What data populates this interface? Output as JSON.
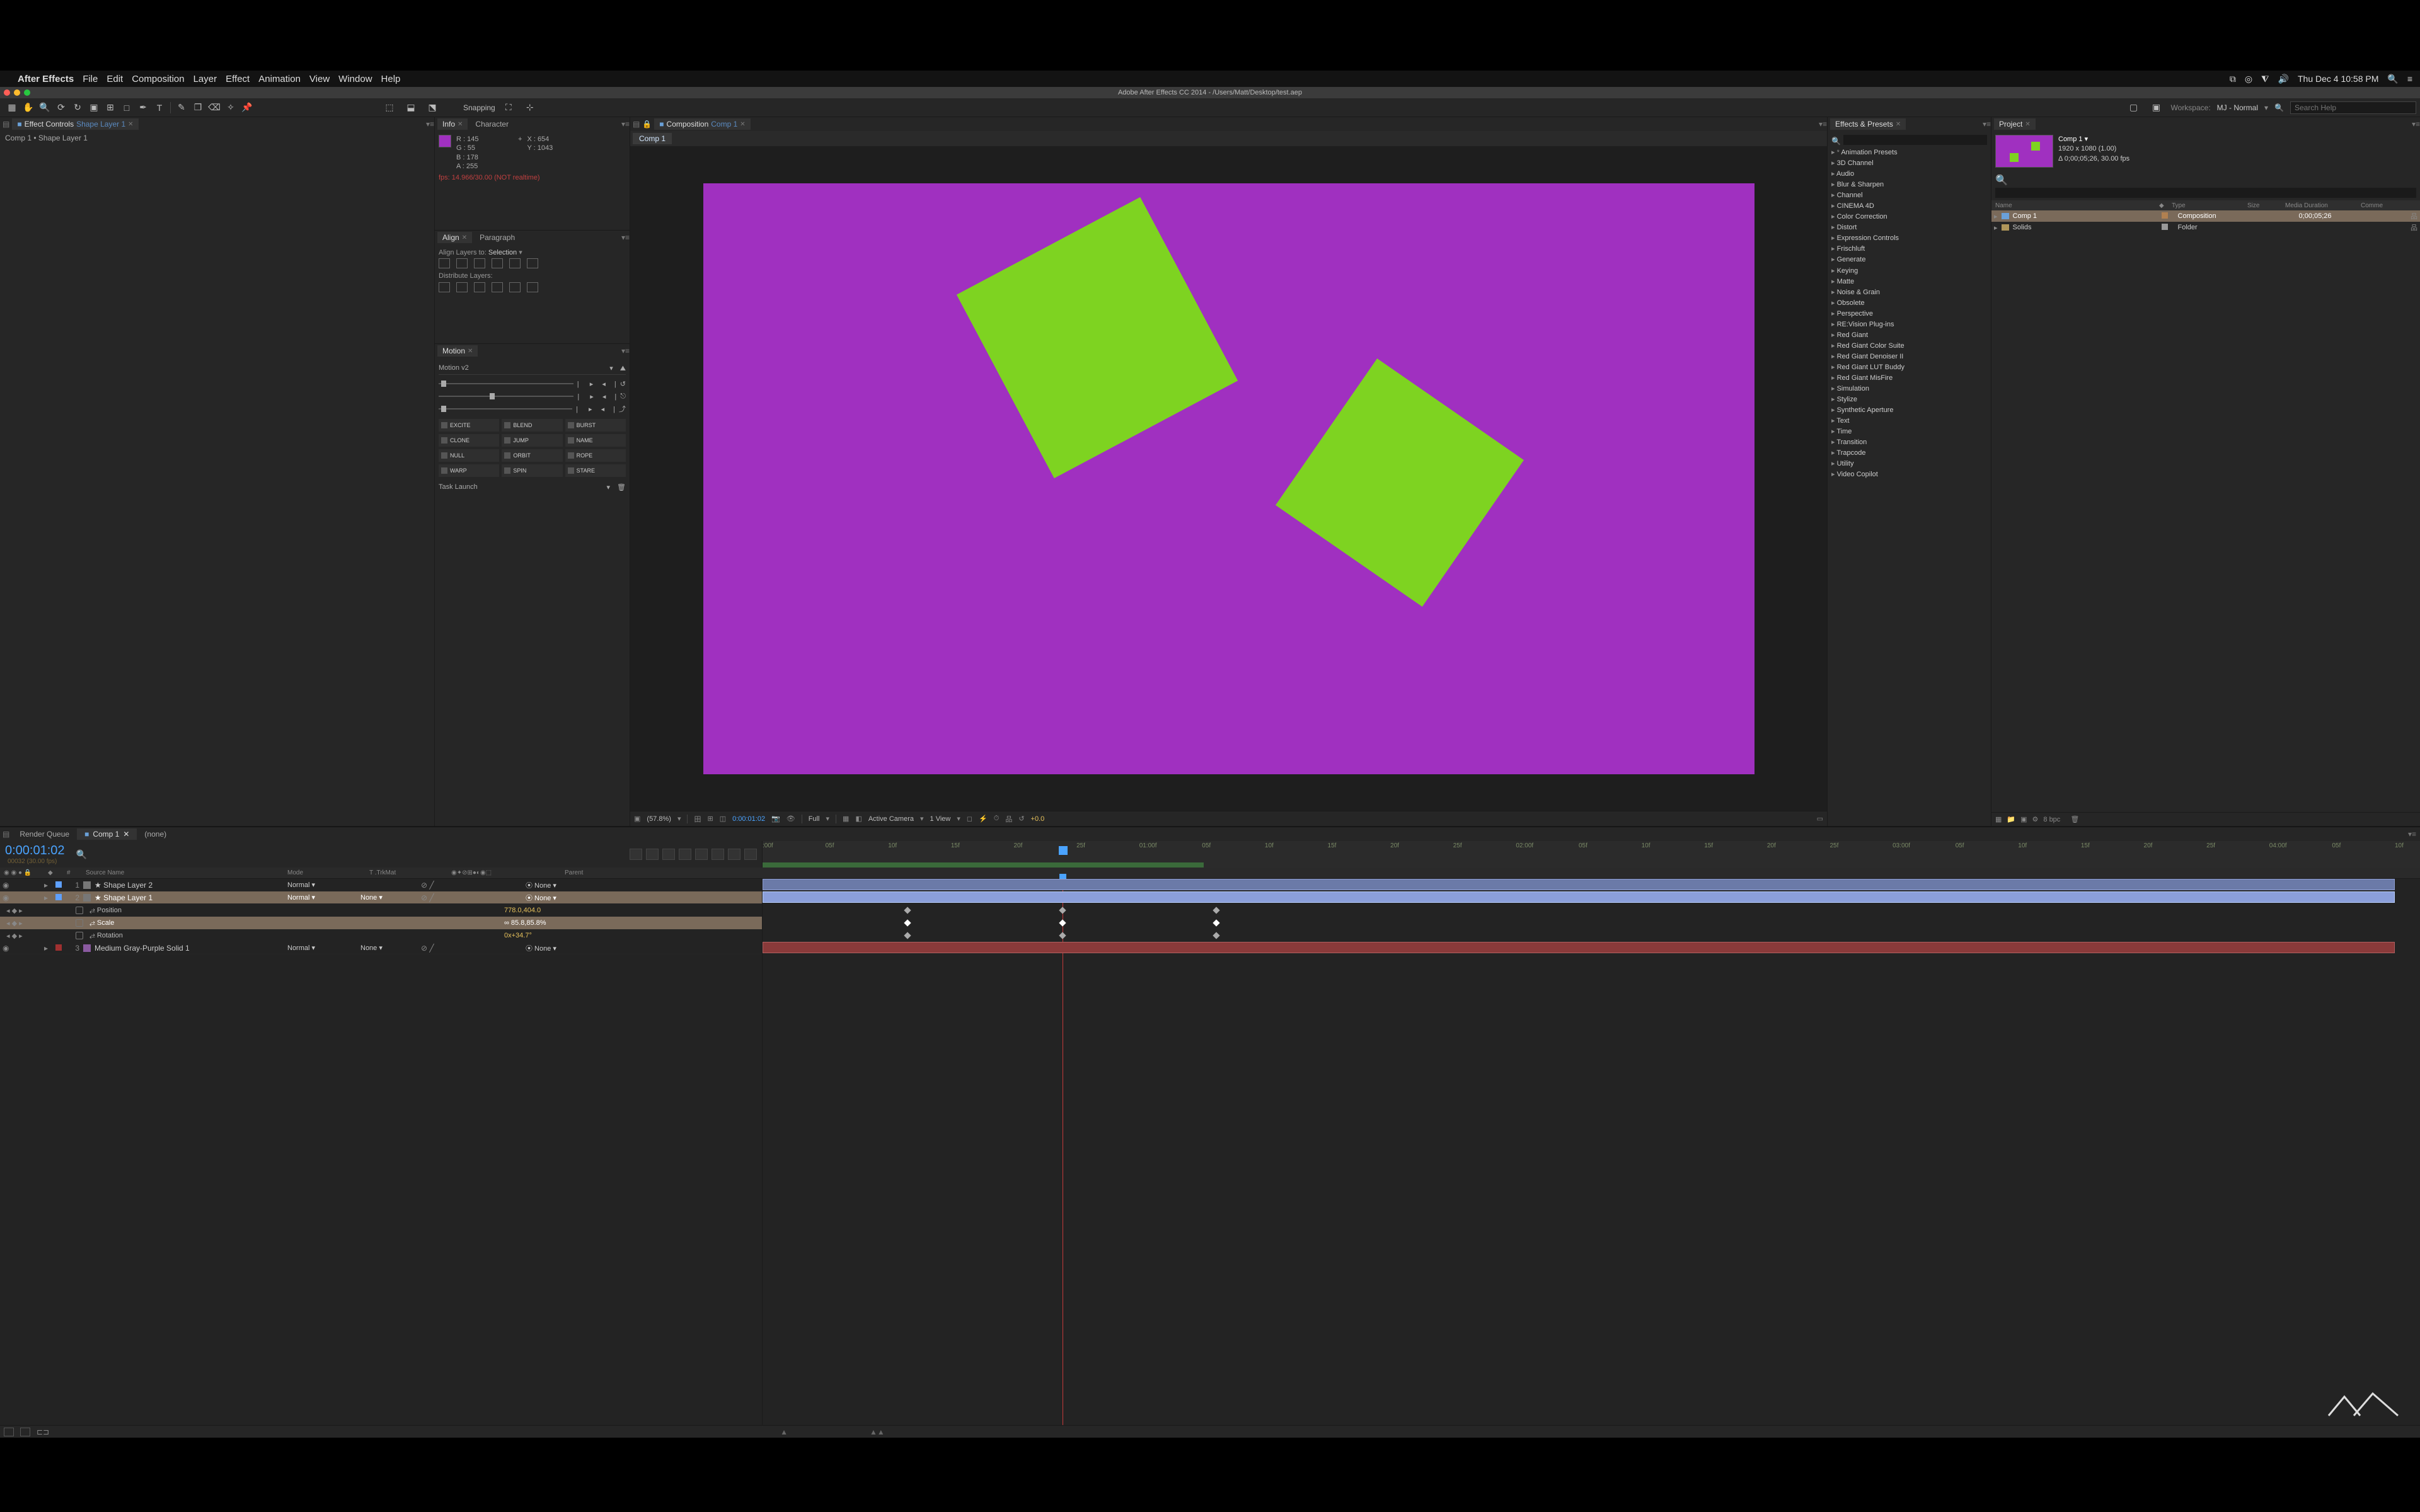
{
  "mac_menu": {
    "app": "After Effects",
    "items": [
      "File",
      "Edit",
      "Composition",
      "Layer",
      "Effect",
      "Animation",
      "View",
      "Window",
      "Help"
    ],
    "clock": "Thu Dec 4  10:58 PM"
  },
  "window_title": "Adobe After Effects CC 2014 - /Users/Matt/Desktop/test.aep",
  "toolbar": {
    "snapping": "Snapping",
    "workspace_label": "Workspace:",
    "workspace_name": "MJ - Normal",
    "search_placeholder": "Search Help"
  },
  "effect_controls": {
    "tab": "Effect Controls",
    "tab_arg": "Shape Layer 1",
    "breadcrumb": "Comp 1 • Shape Layer 1"
  },
  "info": {
    "tab1": "Info",
    "tab2": "Character",
    "r": "R : 145",
    "g": "G : 55",
    "b": "B : 178",
    "a": "A : 255",
    "x": "X : 654",
    "y": "Y : 1043",
    "warn": "fps: 14.966/30.00 (NOT realtime)"
  },
  "align": {
    "tab1": "Align",
    "tab2": "Paragraph",
    "layers_label": "Align Layers to:",
    "layers_value": "Selection",
    "dist_label": "Distribute Layers:"
  },
  "motion": {
    "tab": "Motion",
    "preset": "Motion v2",
    "buttons": [
      "EXCITE",
      "BLEND",
      "BURST",
      "CLONE",
      "JUMP",
      "NAME",
      "NULL",
      "ORBIT",
      "ROPE",
      "WARP",
      "SPIN",
      "STARE"
    ],
    "task": "Task Launch"
  },
  "viewer": {
    "panel": "Composition",
    "panel_arg": "Comp 1",
    "tab": "Comp 1",
    "zoom": "(57.8%)",
    "time": "0:00:01:02",
    "res": "Full",
    "camera": "Active Camera",
    "views": "1 View",
    "exposure": "+0.0"
  },
  "effects_presets": {
    "tab": "Effects & Presets",
    "search_placeholder": "",
    "items": [
      "Animation Presets",
      "3D Channel",
      "Audio",
      "Blur & Sharpen",
      "Channel",
      "CINEMA 4D",
      "Color Correction",
      "Distort",
      "Expression Controls",
      "Frischluft",
      "Generate",
      "Keying",
      "Matte",
      "Noise & Grain",
      "Obsolete",
      "Perspective",
      "RE:Vision Plug-ins",
      "Red Giant",
      "Red Giant Color Suite",
      "Red Giant Denoiser II",
      "Red Giant LUT Buddy",
      "Red Giant MisFire",
      "Simulation",
      "Stylize",
      "Synthetic Aperture",
      "Text",
      "Time",
      "Transition",
      "Trapcode",
      "Utility",
      "Video Copilot"
    ]
  },
  "project": {
    "tab": "Project",
    "thumb_name": "Comp 1 ▾",
    "thumb_dims": "1920 x 1080 (1.00)",
    "thumb_dur": "Δ 0;00;05;26, 30.00 fps",
    "cols": {
      "name": "Name",
      "type": "Type",
      "size": "Size",
      "dur": "Media Duration",
      "comment": "Comme"
    },
    "rows": [
      {
        "name": "Comp 1",
        "type": "Composition",
        "dur": "0;00;05;26",
        "color": "#b08050",
        "sel": true
      },
      {
        "name": "Solids",
        "type": "Folder",
        "dur": "",
        "color": "#999",
        "sel": false
      }
    ],
    "bpc": "8 bpc"
  },
  "timeline": {
    "tabs": {
      "rq": "Render Queue",
      "comp": "Comp 1",
      "none": "(none)"
    },
    "time": "0:00:01:02",
    "subtime": "00032 (30.00 fps)",
    "ruler": [
      ":00f",
      "05f",
      "10f",
      "15f",
      "20f",
      "25f",
      "01:00f",
      "05f",
      "10f",
      "15f",
      "20f",
      "25f",
      "02:00f",
      "05f",
      "10f",
      "15f",
      "20f",
      "25f",
      "03:00f",
      "05f",
      "10f",
      "15f",
      "20f",
      "25f",
      "04:00f",
      "05f",
      "10f"
    ],
    "cols": {
      "source": "Source Name",
      "mode": "Mode",
      "trk": "T  .TrkMat",
      "parent": "Parent"
    },
    "layers": [
      {
        "num": "1",
        "name": "Shape Layer 2",
        "mode": "Normal",
        "trk": "",
        "parent": "None",
        "color": "#5ea0ff",
        "sel": false,
        "kind": "shape"
      },
      {
        "num": "2",
        "name": "Shape Layer 1",
        "mode": "Normal",
        "trk": "None",
        "parent": "None",
        "color": "#5ea0ff",
        "sel": true,
        "kind": "shape"
      },
      {
        "num": "",
        "name": "Position",
        "val": "778.0,404.0",
        "prop": true,
        "sel": false
      },
      {
        "num": "",
        "name": "Scale",
        "val": "∞ 85.8,85.8%",
        "prop": true,
        "sel": true
      },
      {
        "num": "",
        "name": "Rotation",
        "val": "0x+34.7°",
        "prop": true,
        "sel": false
      },
      {
        "num": "3",
        "name": "Medium Gray-Purple Solid 1",
        "mode": "Normal",
        "trk": "None",
        "parent": "None",
        "color": "#a03030",
        "sel": false,
        "kind": "solid"
      }
    ]
  }
}
